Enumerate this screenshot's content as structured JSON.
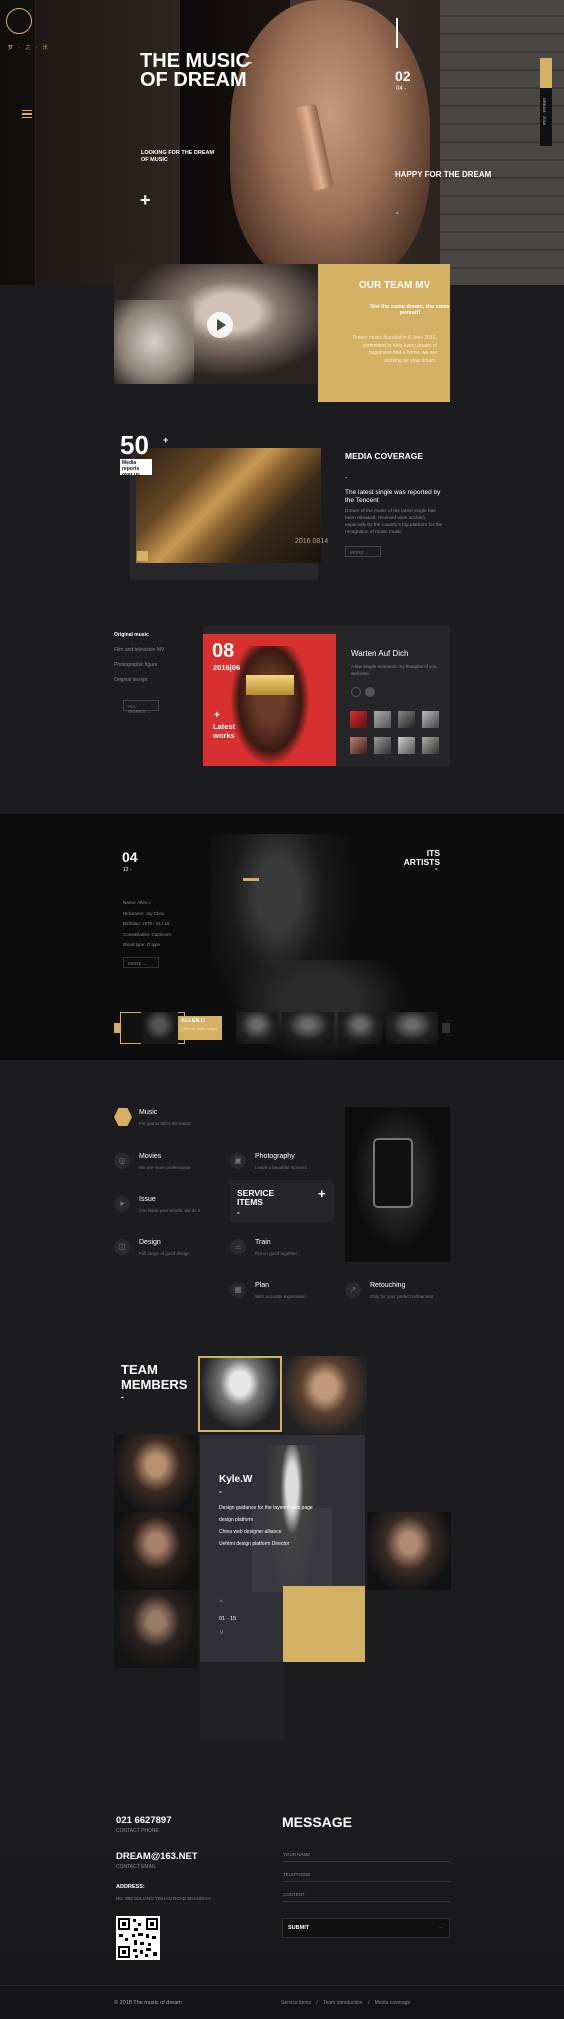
{
  "hero": {
    "logo_text": "梦 · 之 · 乐",
    "title": "THE MUSIC OF DREAM",
    "dash": "-",
    "subtitle": "LOOKING FOR THE DREAM OF MUSIC",
    "plus": "+",
    "slide_num": "02",
    "slide_sub": "04 -",
    "happy": "HAPPY FOR THE DREAM",
    "happy_dash": "-",
    "side_tab": "DREAM · 2018"
  },
  "team_mv": {
    "title": "OUR TEAM MV",
    "headline": "Not the same dream, the same pursuit!",
    "text": "Dream music founded in 6 June 2016, committed to help every dream of happiness find a home, we are working for your dream."
  },
  "media": {
    "count": "50",
    "plus": "+",
    "badge": "Media reports over us.",
    "year": "2016 0814",
    "title": "MEDIA COVERAGE",
    "dash": "-",
    "headline": "The latest single was reported by the Tencent",
    "text": "Dream of the music of the latest single has been released, received wide acclaim, especially by the country's big platform for the recognition of music music",
    "more": "MORE →"
  },
  "original": {
    "items": [
      "Original music",
      "Film and television MV",
      "Photographic figure",
      "Original design"
    ],
    "button": "ALL WORKS →",
    "num": "08",
    "date": "2016|06",
    "latest": "Latest works",
    "plus": "+",
    "song_title": "Warten Auf Dich",
    "song_text": "A few simple moments, my thoughts of you, welcome."
  },
  "artists": {
    "num": "04",
    "sub": "12 -",
    "title": "ITS ARTISTS",
    "dash": "-",
    "info": [
      "Name: Allen.c",
      "Nickname: Jay Chou",
      "Birthday: 1979 / 01 / 18",
      "Constellation: Capricorn",
      "Blood type: O type"
    ],
    "more": "MORE →",
    "active_name": "ALLEN.C",
    "active_sub": "Chinese male singer"
  },
  "services": {
    "box_title": "SERVICE ITEMS",
    "box_dash": "-",
    "box_plus": "+",
    "items": [
      {
        "title": "Music",
        "desc": "For you to tailor the music"
      },
      {
        "title": "Movies",
        "desc": "We are more professional"
      },
      {
        "title": "Photography",
        "desc": "Leave a beautiful moment"
      },
      {
        "title": "Issue",
        "desc": "You issue your mouth, we do it"
      },
      {
        "title": "Design",
        "desc": "Full range of good design"
      },
      {
        "title": "Train",
        "desc": "Put on good together"
      },
      {
        "title": "Plan",
        "desc": "With accurate expression"
      },
      {
        "title": "Retouching",
        "desc": "Only for your perfect refinement"
      }
    ]
  },
  "team": {
    "title": "TEAM MEMBERS",
    "dash": "-",
    "name": "Kyle.W",
    "name_dash": "-",
    "lines": [
      "Design guidance for the layered web page",
      "design platform",
      "China web designer alliance",
      "Uehtml design platform Director"
    ],
    "up": "^",
    "counter": "01 - 15",
    "down": "v"
  },
  "contact": {
    "phone": "021 6627897",
    "phone_label": "CONTACT PHONE",
    "email": "DREAM@163.NET",
    "email_label": "CONTACT EMAIL",
    "address_label": "ADDRESS:",
    "address": "NO. 888 SULIANG YISHAN ROAD SHANGHAI"
  },
  "message": {
    "title": "MESSAGE",
    "name_label": "YOUR NAME",
    "phone_label": "TELEPHONE",
    "content_label": "CONTENT",
    "submit": "SUBMIT",
    "submit_arrow": "→"
  },
  "footer": {
    "copyright": "© 2018 The music of dream",
    "links": [
      "Service items",
      "/",
      "Team introduction",
      "/",
      "Media coverage"
    ]
  },
  "colors": {
    "accent": "#d4b062",
    "background": "#1d1d20"
  }
}
